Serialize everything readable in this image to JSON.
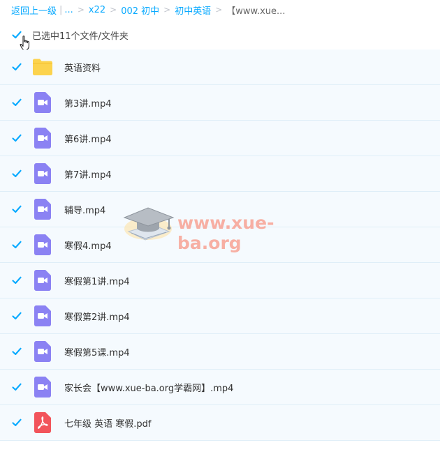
{
  "breadcrumb": {
    "back": "返回上一级",
    "ellipsis": "...",
    "items": [
      "x22",
      "002 初中",
      "初中英语"
    ],
    "current": "【www.xue..."
  },
  "selection": {
    "label": "已选中11个文件/文件夹",
    "checked": true
  },
  "files": [
    {
      "name": "英语资料",
      "type": "folder"
    },
    {
      "name": "第3讲.mp4",
      "type": "video"
    },
    {
      "name": "第6讲.mp4",
      "type": "video"
    },
    {
      "name": "第7讲.mp4",
      "type": "video"
    },
    {
      "name": "辅导.mp4",
      "type": "video"
    },
    {
      "name": "寒假4.mp4",
      "type": "video"
    },
    {
      "name": "寒假第1讲.mp4",
      "type": "video"
    },
    {
      "name": "寒假第2讲.mp4",
      "type": "video"
    },
    {
      "name": "寒假第5课.mp4",
      "type": "video"
    },
    {
      "name": "家长会【www.xue-ba.org学霸网】.mp4",
      "type": "video"
    },
    {
      "name": "七年级 英语 寒假.pdf",
      "type": "pdf"
    }
  ],
  "watermark": {
    "text": "www.xue-ba.org",
    "icon": "graduation-cap-icon"
  },
  "colors": {
    "accent": "#09aaff",
    "checkbox": "#09aaff",
    "folder": "#fcd34d",
    "video": "#8b82f3",
    "pdf": "#f2545b",
    "row_bg": "#f5fafe",
    "row_border": "#dfeef8"
  }
}
